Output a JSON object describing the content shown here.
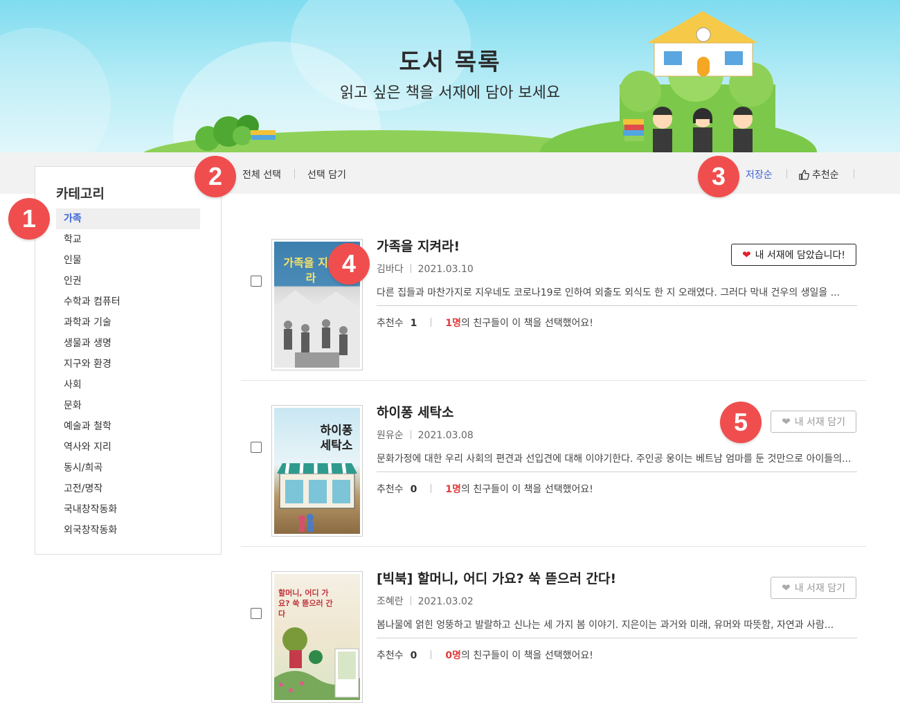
{
  "banner": {
    "title": "도서 목록",
    "subtitle": "읽고 싶은 책을 서재에 담아 보세요"
  },
  "toolbar": {
    "select_all": "전체 선택",
    "add_selected": "선택 담기",
    "sort_shelf": "저장순",
    "sort_recommend": "추천순"
  },
  "markers": [
    "1",
    "2",
    "3",
    "4",
    "5"
  ],
  "sidebar": {
    "title": "카테고리",
    "items": [
      {
        "label": "가족",
        "active": true
      },
      {
        "label": "학교"
      },
      {
        "label": "인물"
      },
      {
        "label": "인권"
      },
      {
        "label": "수학과 컴퓨터"
      },
      {
        "label": "과학과 기술"
      },
      {
        "label": "생물과 생명"
      },
      {
        "label": "지구와 환경"
      },
      {
        "label": "사회"
      },
      {
        "label": "문화"
      },
      {
        "label": "예술과 철학"
      },
      {
        "label": "역사와 지리"
      },
      {
        "label": "동시/희곡"
      },
      {
        "label": "고전/명작"
      },
      {
        "label": "국내창작동화"
      },
      {
        "label": "외국창작동화"
      }
    ]
  },
  "books": [
    {
      "title": "가족을 지켜라!",
      "author": "김바다",
      "date": "2021.03.10",
      "description": "다른 집들과 마찬가지로 지우네도 코로나19로 인하여 외출도 외식도 한 지 오래였다. 그러다 막내 건우의 생일을 ...",
      "recommend_label": "추천수",
      "recommend_count": "1",
      "friends_count": "1명",
      "friends_text": "의 친구들이 이 책을 선택했어요!",
      "shelf_label": "내 서재에 담았습니다!",
      "cover_title": "가족을 지켜라",
      "on_shelf": true
    },
    {
      "title": "하이퐁 세탁소",
      "author": "원유순",
      "date": "2021.03.08",
      "description": "문화가정에 대한 우리 사회의 편견과 선입견에 대해 이야기한다. 주인공 웅이는 베트남 엄마를 둔 것만으로 아이들의...",
      "recommend_label": "추천수",
      "recommend_count": "0",
      "friends_count": "1명",
      "friends_text": "의 친구들이 이 책을 선택했어요!",
      "shelf_label": "내 서재 담기",
      "cover_title": "하이퐁 세탁소",
      "on_shelf": false
    },
    {
      "title": "[빅북] 할머니, 어디 가요? 쑥 뜯으러 간다!",
      "author": "조혜란",
      "date": "2021.03.02",
      "description": "봄나물에 얽힌 엉뚱하고 발랄하고 신나는 세 가지 봄 이야기. 지은이는 과거와 미래, 유머와 따뜻함, 자연과 사람...",
      "recommend_label": "추천수",
      "recommend_count": "0",
      "friends_count": "0명",
      "friends_text": "의 친구들이 이 책을 선택했어요!",
      "shelf_label": "내 서재 담기",
      "cover_title": "할머니, 어디 가요? 쑥 뜯으러 간다",
      "on_shelf": false
    }
  ],
  "colors": {
    "accent": "#3d63d6",
    "marker": "#f04e4e",
    "heart_on": "#e0202a",
    "count_red": "#e03c3c"
  }
}
